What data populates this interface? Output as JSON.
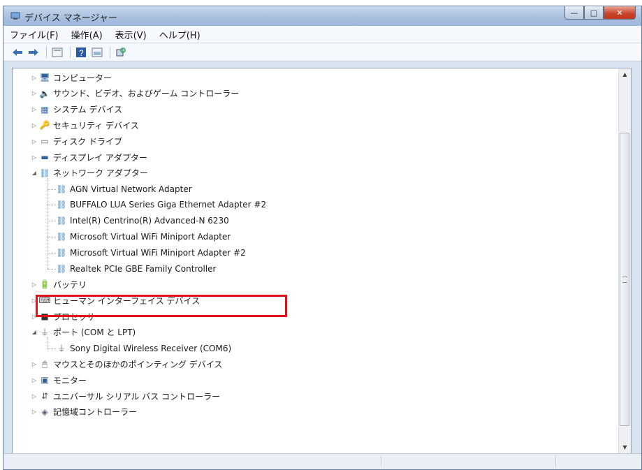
{
  "window": {
    "title": "デバイス マネージャー",
    "menu": [
      "ファイル(F)",
      "操作(A)",
      "表示(V)",
      "ヘルプ(H)"
    ],
    "toolbar": [
      "back-icon",
      "forward-icon",
      "properties-icon",
      "help-icon",
      "view-icon",
      "scan-hardware-icon"
    ]
  },
  "tree": [
    {
      "label": "コンピューター",
      "icon": "computer-icon",
      "expand": "collapsed"
    },
    {
      "label": "サウンド、ビデオ、およびゲーム コントローラー",
      "icon": "speaker-icon",
      "expand": "collapsed"
    },
    {
      "label": "システム デバイス",
      "icon": "system-icon",
      "expand": "collapsed"
    },
    {
      "label": "セキュリティ デバイス",
      "icon": "key-icon",
      "expand": "collapsed"
    },
    {
      "label": "ディスク ドライブ",
      "icon": "disk-icon",
      "expand": "collapsed"
    },
    {
      "label": "ディスプレイ アダプター",
      "icon": "display-icon",
      "expand": "collapsed"
    },
    {
      "label": "ネットワーク アダプター",
      "icon": "network-icon",
      "expand": "expanded"
    },
    {
      "label": "AGN Virtual Network Adapter",
      "icon": "network-icon",
      "child": true
    },
    {
      "label": "BUFFALO LUA Series Giga Ethernet Adapter #2",
      "icon": "network-icon",
      "child": true
    },
    {
      "label": "Intel(R) Centrino(R) Advanced-N 6230",
      "icon": "network-icon",
      "child": true
    },
    {
      "label": "Microsoft Virtual WiFi Miniport Adapter",
      "icon": "network-icon",
      "child": true
    },
    {
      "label": "Microsoft Virtual WiFi Miniport Adapter #2",
      "icon": "network-icon",
      "child": true
    },
    {
      "label": "Realtek PCIe GBE Family Controller",
      "icon": "network-icon",
      "child": true
    },
    {
      "label": "バッテリ",
      "icon": "battery-icon",
      "expand": "collapsed"
    },
    {
      "label": "ヒューマン インターフェイス デバイス",
      "icon": "hid-icon",
      "expand": "collapsed"
    },
    {
      "label": "プロセッサ",
      "icon": "processor-icon",
      "expand": "collapsed"
    },
    {
      "label": "ポート (COM と LPT)",
      "icon": "port-icon",
      "expand": "expanded"
    },
    {
      "label": "Sony Digital Wireless Receiver (COM6)",
      "icon": "port-icon",
      "child": true
    },
    {
      "label": "マウスとそのほかのポインティング デバイス",
      "icon": "mouse-icon",
      "expand": "collapsed"
    },
    {
      "label": "モニター",
      "icon": "monitor-icon",
      "expand": "collapsed"
    },
    {
      "label": "ユニバーサル シリアル バス コントローラー",
      "icon": "usb-icon",
      "expand": "collapsed"
    },
    {
      "label": "記憶域コントローラー",
      "icon": "storage-icon",
      "expand": "collapsed"
    }
  ],
  "highlight_color": "#e4121a"
}
